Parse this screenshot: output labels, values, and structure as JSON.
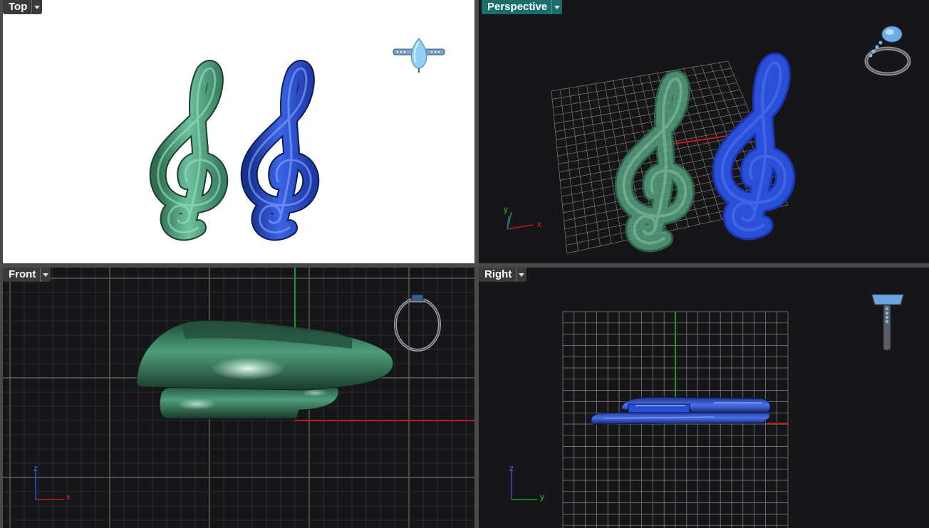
{
  "viewports": {
    "top": {
      "label": "Top"
    },
    "perspective": {
      "label": "Perspective",
      "active": true
    },
    "front": {
      "label": "Front"
    },
    "right": {
      "label": "Right"
    }
  },
  "axes": {
    "perspective": {
      "x": "x",
      "y": "y"
    },
    "front": {
      "x": "x",
      "z": "z"
    },
    "right": {
      "y": "y",
      "z": "z"
    }
  },
  "colors": {
    "active_tab": "#1b6e6e",
    "viewport_bg": "#161518",
    "top_bg": "#ffffff",
    "model_green": "#4e9e7a",
    "model_blue": "#2446c4",
    "x_axis": "#c81818",
    "y_axis": "#1f9a1f",
    "z_axis": "#3050d0",
    "grid": "#6a6a6a"
  },
  "icons": [
    "dropdown-arrow-icon",
    "ring-icon",
    "treble-clef-model"
  ]
}
